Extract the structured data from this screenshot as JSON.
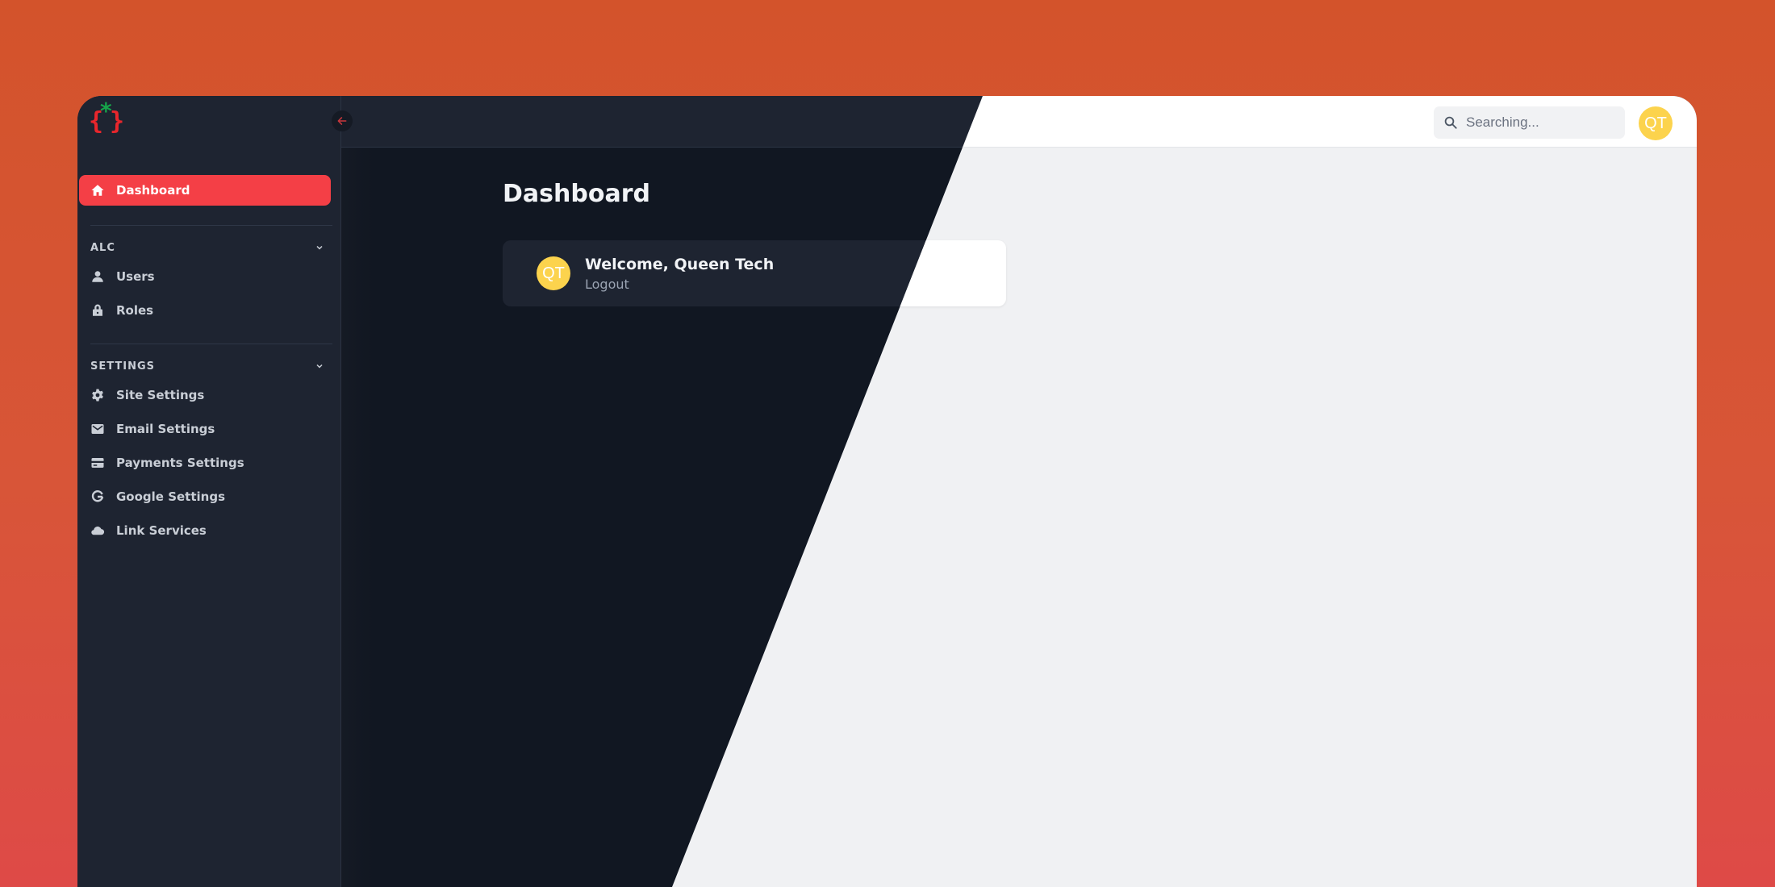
{
  "app": {
    "logo": {
      "left_brace": "{",
      "right_brace": "}",
      "star": "*"
    },
    "colors": {
      "accent": "#f43f46",
      "logo_red": "#e8262c",
      "logo_green": "#16a34a",
      "avatar_yellow": "#fcd34d",
      "background_top": "#d3532b",
      "background_bottom": "#de4a47"
    }
  },
  "sidebar": {
    "collapse_icon": "arrow-left-icon",
    "primary": {
      "label": "Dashboard",
      "icon": "home-icon",
      "active": true
    },
    "sections": [
      {
        "title": "ALC",
        "expanded": true,
        "items": [
          {
            "label": "Users",
            "icon": "user-icon"
          },
          {
            "label": "Roles",
            "icon": "lock-icon"
          }
        ]
      },
      {
        "title": "SETTINGS",
        "expanded": true,
        "items": [
          {
            "label": "Site Settings",
            "icon": "gear-icon"
          },
          {
            "label": "Email Settings",
            "icon": "mail-icon"
          },
          {
            "label": "Payments Settings",
            "icon": "credit-card-icon"
          },
          {
            "label": "Google Settings",
            "icon": "google-icon"
          },
          {
            "label": "Link Services",
            "icon": "cloud-icon"
          }
        ]
      }
    ]
  },
  "header": {
    "search": {
      "placeholder": "Searching...",
      "value": "",
      "icon": "search-icon"
    },
    "user_initials": "QT"
  },
  "main": {
    "title": "Dashboard",
    "welcome_card": {
      "initials": "QT",
      "greeting": "Welcome, Queen Tech",
      "logout_label": "Logout"
    }
  }
}
